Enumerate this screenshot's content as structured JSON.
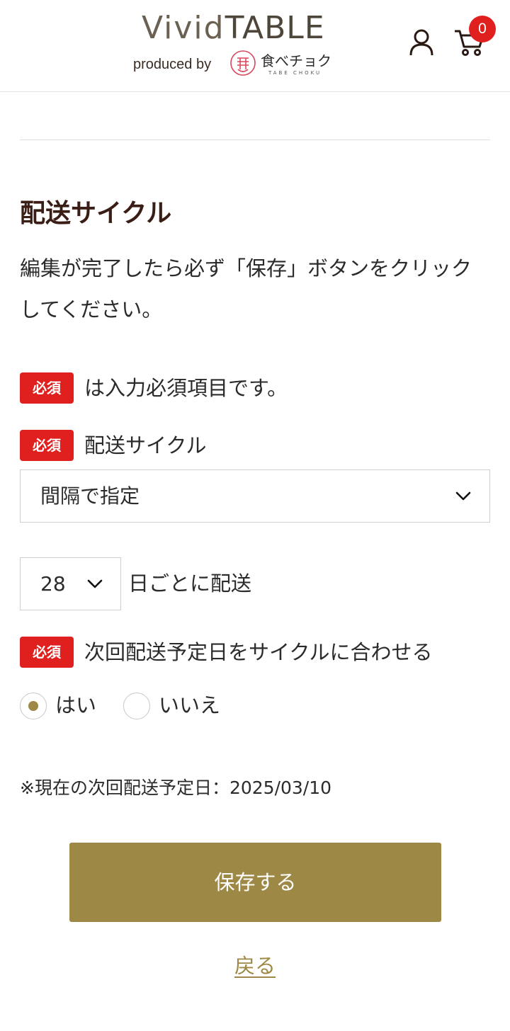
{
  "header": {
    "logo_main_vivid": "Vivid",
    "logo_main_table": "TABLE",
    "logo_sub": "produced by",
    "logo_brand": "食べチョク",
    "logo_brand_sub": "TABE CHOKU",
    "cart_count": "0",
    "icons": {
      "account": "account-icon",
      "cart": "cart-icon"
    }
  },
  "form": {
    "title": "配送サイクル",
    "instruction": "編集が完了したら必ず「保存」ボタンをクリックしてください。",
    "required_badge": "必須",
    "required_note": "は入力必須項目です。",
    "cycle_label": "配送サイクル",
    "cycle_selected": "間隔で指定",
    "days_selected": "28",
    "days_suffix": "日ごとに配送",
    "align_label": "次回配送予定日をサイクルに合わせる",
    "align_options": [
      {
        "label": "はい",
        "checked": true
      },
      {
        "label": "いいえ",
        "checked": false
      }
    ],
    "next_date": "※現在の次回配送予定日：2025/03/10",
    "save_label": "保存する",
    "back_label": "戻る"
  },
  "colors": {
    "accent": "#9e8845",
    "required": "#e0201e",
    "title": "#3a1e16"
  }
}
